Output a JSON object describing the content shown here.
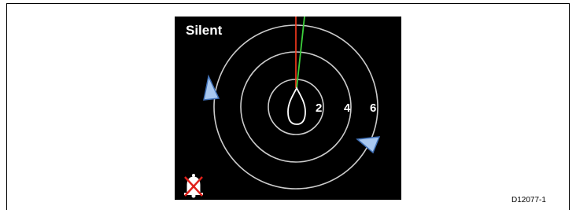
{
  "screen": {
    "mode_label": "Silent",
    "range_rings": [
      "2",
      "4",
      "6"
    ],
    "heading_line_color": "#ff3b1f",
    "course_line_color": "#3ccf3c",
    "ring_color": "#cccccc",
    "target_color": "#a8c8f0",
    "icons": [
      "vessel-outline-icon",
      "target-arrow-icon",
      "alarm-muted-icon"
    ]
  },
  "figure": {
    "reference": "D12077-1"
  }
}
